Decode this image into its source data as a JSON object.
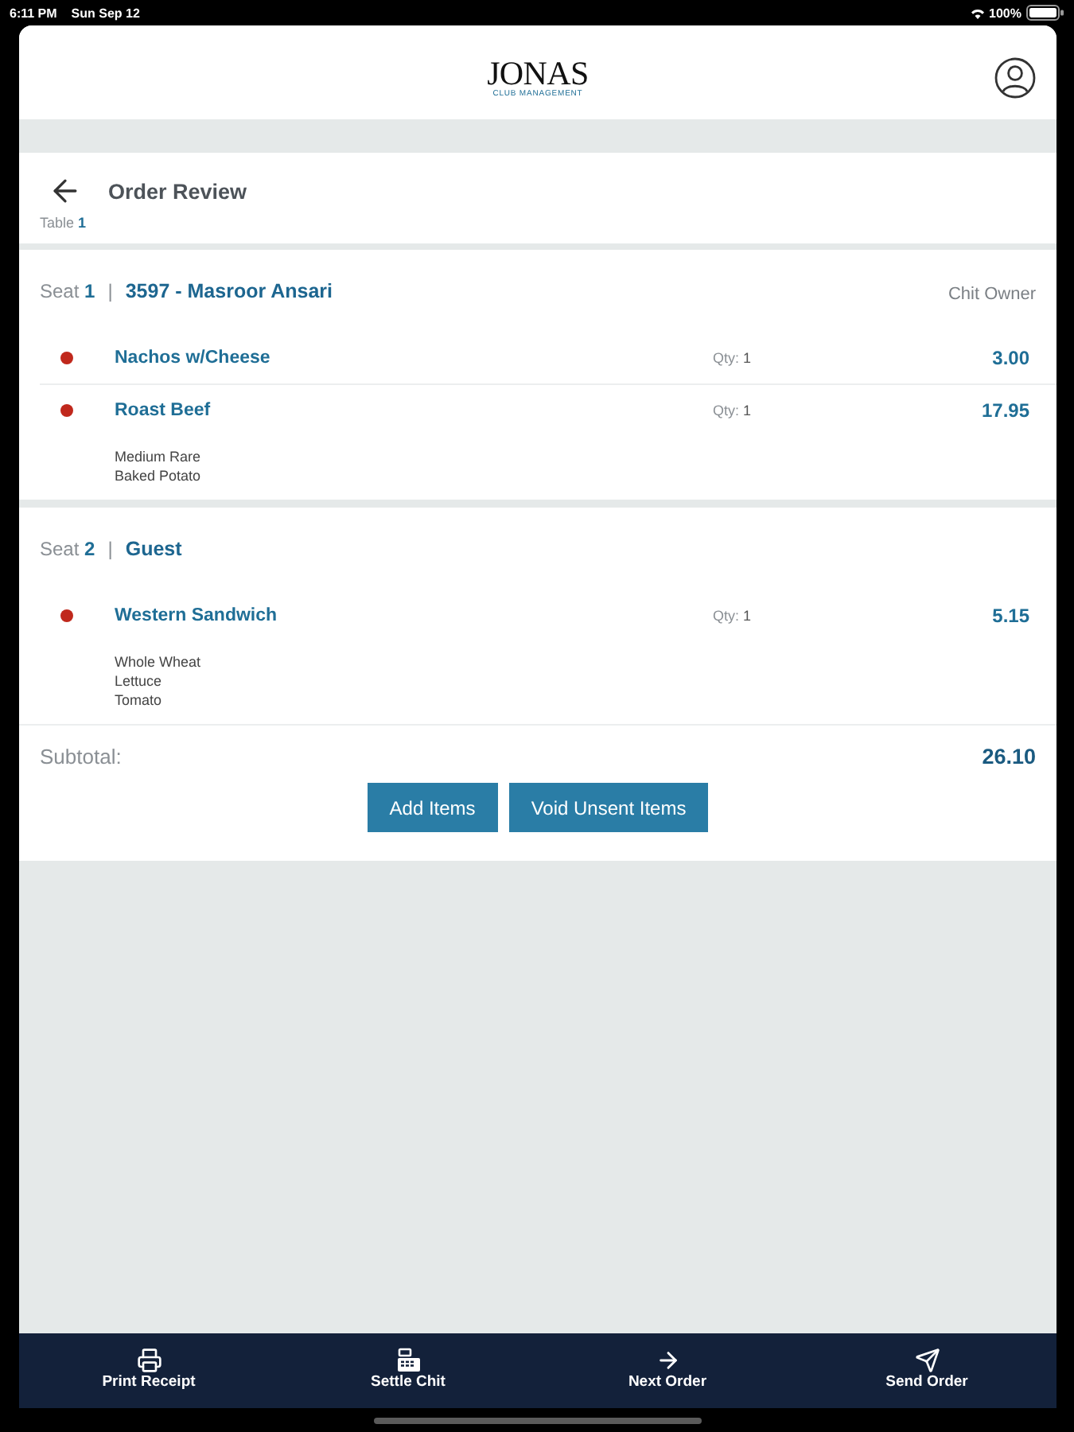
{
  "status_bar": {
    "time": "6:11 PM",
    "date": "Sun Sep 12",
    "battery": "100%"
  },
  "header": {
    "logo": "JONAS",
    "logo_tagline": "CLUB MANAGEMENT"
  },
  "title_bar": {
    "title": "Order Review",
    "table_label": "Table",
    "table_number": "1"
  },
  "seats": [
    {
      "label": "Seat",
      "number": "1",
      "separator": "|",
      "name": "3597 - Masroor Ansari",
      "role": "Chit Owner",
      "items": [
        {
          "name": "Nachos w/Cheese",
          "qty_label": "Qty:",
          "qty": "1",
          "price": "3.00",
          "color": "#c0281c"
        },
        {
          "name": "Roast Beef",
          "qty_label": "Qty:",
          "qty": "1",
          "price": "17.95",
          "color": "#c0281c",
          "modifiers": [
            "Medium Rare",
            "Baked Potato"
          ]
        }
      ]
    },
    {
      "label": "Seat",
      "number": "2",
      "separator": "|",
      "name": "Guest",
      "items": [
        {
          "name": "Western Sandwich",
          "qty_label": "Qty:",
          "qty": "1",
          "price": "5.15",
          "color": "#c0281c",
          "modifiers": [
            "Whole Wheat",
            "Lettuce",
            "Tomato"
          ]
        }
      ]
    }
  ],
  "summary": {
    "label": "Subtotal:",
    "amount": "26.10"
  },
  "actions": [
    {
      "label": "Add Items"
    },
    {
      "label": "Void Unsent Items"
    }
  ],
  "bottom_nav": [
    {
      "kind": "print",
      "label": "Print Receipt"
    },
    {
      "kind": "settle",
      "label": "Settle Chit"
    },
    {
      "kind": "next",
      "label": "Next Order"
    },
    {
      "kind": "send",
      "label": "Send Order"
    }
  ]
}
